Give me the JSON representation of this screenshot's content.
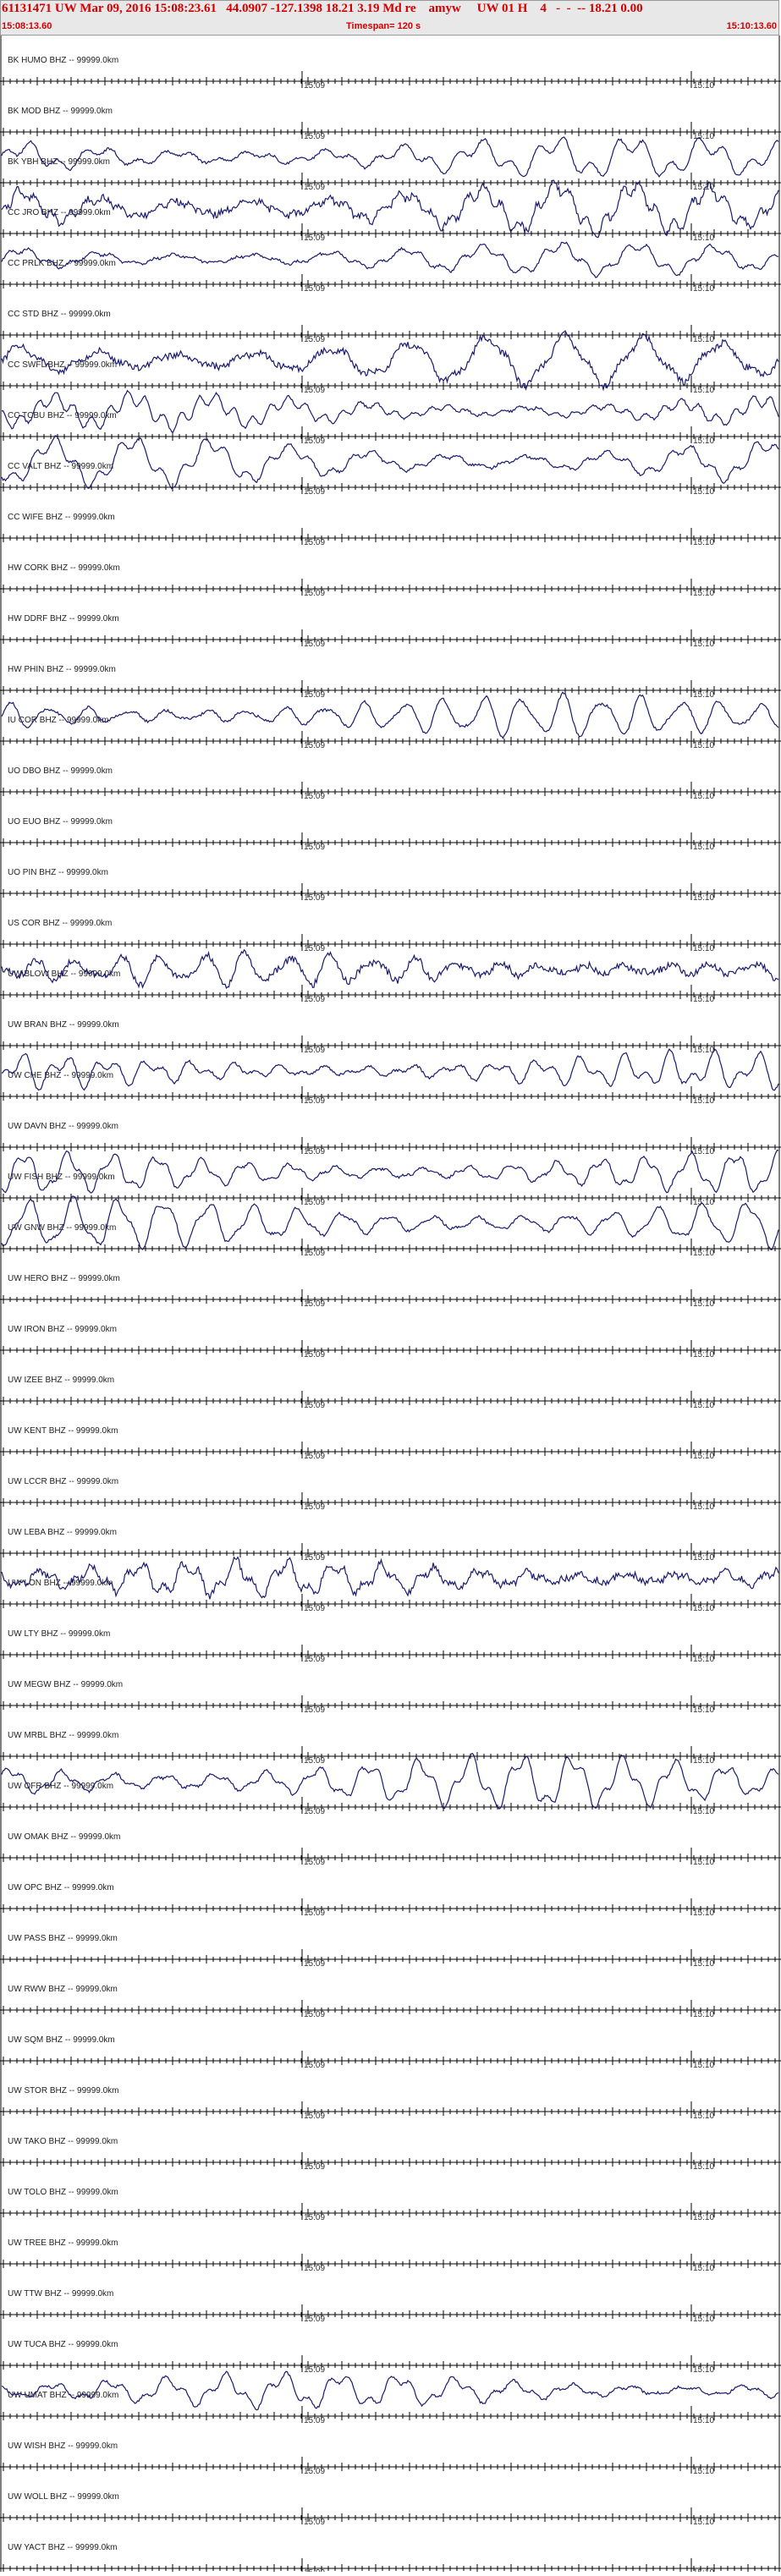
{
  "header": {
    "title": "61131471 UW Mar 09, 2016 15:08:23.61   44.0907 -127.1398 18.21 3.19 Md re    amyw     UW 01 H    4   -  -  -- 18.21 0.00",
    "start_time": "15:08:13.60",
    "timespan": "Timespan= 120 s",
    "end_time": "15:10:13.60"
  },
  "colors": {
    "trace": "#1a1a6e",
    "header_text": "#d40000",
    "grid": "#000000"
  },
  "chart_data": {
    "type": "line",
    "title": "61131471 UW Mar 09, 2016 15:08:23.61",
    "xlabel": "",
    "ylabel": "",
    "timespan_s": 120,
    "time_ticks": [
      "15:09",
      "15:10"
    ],
    "traces": [
      {
        "label": "BK HUMO BHZ -- 99999.0km",
        "active": false
      },
      {
        "label": "BK MOD BHZ -- 99999.0km",
        "active": false
      },
      {
        "label": "BK YBH BHZ -- 99999.0km",
        "active": true
      },
      {
        "label": "CC JRO BHZ -- 99999.0km",
        "active": true
      },
      {
        "label": "CC PRLK BHZ -- 99999.0km",
        "active": true
      },
      {
        "label": "CC STD BHZ -- 99999.0km",
        "active": false
      },
      {
        "label": "CC SWFL BHZ -- 99999.0km",
        "active": true
      },
      {
        "label": "CC TCBU BHZ -- 99999.0km",
        "active": true
      },
      {
        "label": "CC VALT BHZ -- 99999.0km",
        "active": true
      },
      {
        "label": "CC WIFE BHZ -- 99999.0km",
        "active": false
      },
      {
        "label": "HW CORK BHZ -- 99999.0km",
        "active": false
      },
      {
        "label": "HW DDRF BHZ -- 99999.0km",
        "active": false
      },
      {
        "label": "HW PHIN BHZ -- 99999.0km",
        "active": false
      },
      {
        "label": "IU COR BHZ -- 99999.0km",
        "active": true
      },
      {
        "label": "UO DBO BHZ -- 99999.0km",
        "active": false
      },
      {
        "label": "UO EUO BHZ -- 99999.0km",
        "active": false
      },
      {
        "label": "UO PIN BHZ -- 99999.0km",
        "active": false
      },
      {
        "label": "US COR BHZ -- 99999.0km",
        "active": false
      },
      {
        "label": "UW BLOW BHZ -- 99999.0km",
        "active": true
      },
      {
        "label": "UW BRAN BHZ -- 99999.0km",
        "active": false
      },
      {
        "label": "UW CHE BHZ -- 99999.0km",
        "active": true
      },
      {
        "label": "UW DAVN BHZ -- 99999.0km",
        "active": false
      },
      {
        "label": "UW FISH BHZ -- 99999.0km",
        "active": true
      },
      {
        "label": "UW GNW BHZ -- 99999.0km",
        "active": true
      },
      {
        "label": "UW HERO BHZ -- 99999.0km",
        "active": false
      },
      {
        "label": "UW IRON BHZ -- 99999.0km",
        "active": false
      },
      {
        "label": "UW IZEE BHZ -- 99999.0km",
        "active": false
      },
      {
        "label": "UW KENT BHZ -- 99999.0km",
        "active": false
      },
      {
        "label": "UW LCCR BHZ -- 99999.0km",
        "active": false
      },
      {
        "label": "UW LEBA BHZ -- 99999.0km",
        "active": false
      },
      {
        "label": "UW LON BHZ -- 99999.0km",
        "active": true
      },
      {
        "label": "UW LTY BHZ -- 99999.0km",
        "active": false
      },
      {
        "label": "UW MEGW BHZ -- 99999.0km",
        "active": false
      },
      {
        "label": "UW MRBL BHZ -- 99999.0km",
        "active": false
      },
      {
        "label": "UW OFR BHZ -- 99999.0km",
        "active": true
      },
      {
        "label": "UW OMAK BHZ -- 99999.0km",
        "active": false
      },
      {
        "label": "UW OPC BHZ -- 99999.0km",
        "active": false
      },
      {
        "label": "UW PASS BHZ -- 99999.0km",
        "active": false
      },
      {
        "label": "UW RWW BHZ -- 99999.0km",
        "active": false
      },
      {
        "label": "UW SQM BHZ -- 99999.0km",
        "active": false
      },
      {
        "label": "UW STOR BHZ -- 99999.0km",
        "active": false
      },
      {
        "label": "UW TAKO BHZ -- 99999.0km",
        "active": false
      },
      {
        "label": "UW TOLO BHZ -- 99999.0km",
        "active": false
      },
      {
        "label": "UW TREE BHZ -- 99999.0km",
        "active": false
      },
      {
        "label": "UW TTW BHZ -- 99999.0km",
        "active": false
      },
      {
        "label": "UW TUCA BHZ -- 99999.0km",
        "active": false
      },
      {
        "label": "UW UMAT BHZ -- 99999.0km",
        "active": true
      },
      {
        "label": "UW WISH BHZ -- 99999.0km",
        "active": false
      },
      {
        "label": "UW WOLL BHZ -- 99999.0km",
        "active": false
      },
      {
        "label": "UW YACT BHZ -- 99999.0km",
        "active": false
      }
    ]
  }
}
